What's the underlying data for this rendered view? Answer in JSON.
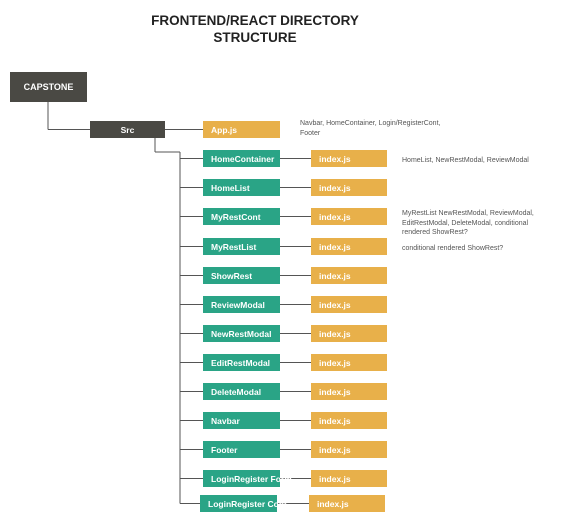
{
  "title_line1": "FRONTEND/REACT DIRECTORY",
  "title_line2": "STRUCTURE",
  "root_label": "CAPSTONE",
  "src_label": "Src",
  "app_label": "App.js",
  "app_note": "Navbar, HomeContainer, Login/RegisterCont, Footer",
  "index_label": "index.js",
  "components": [
    {
      "label": "HomeContainer",
      "note": "HomeList, NewRestModal, ReviewModal"
    },
    {
      "label": "HomeList",
      "note": ""
    },
    {
      "label": "MyRestCont",
      "note": "MyRestList NewRestModal, ReviewModal, EditRestModal, DeleteModal, conditional rendered ShowRest?"
    },
    {
      "label": "MyRestList",
      "note": "conditional rendered ShowRest?"
    },
    {
      "label": "ShowRest",
      "note": ""
    },
    {
      "label": "ReviewModal",
      "note": ""
    },
    {
      "label": "NewRestModal",
      "note": ""
    },
    {
      "label": "EditRestModal",
      "note": ""
    },
    {
      "label": "DeleteModal",
      "note": ""
    },
    {
      "label": "Navbar",
      "note": ""
    },
    {
      "label": "Footer",
      "note": ""
    },
    {
      "label": "LoginRegister Form",
      "note": ""
    },
    {
      "label": "LoginRegister Cont",
      "note": ""
    }
  ],
  "colors": {
    "dark": "#4a4944",
    "teal": "#2aa486",
    "gold": "#e8b04a",
    "line": "#555555"
  }
}
